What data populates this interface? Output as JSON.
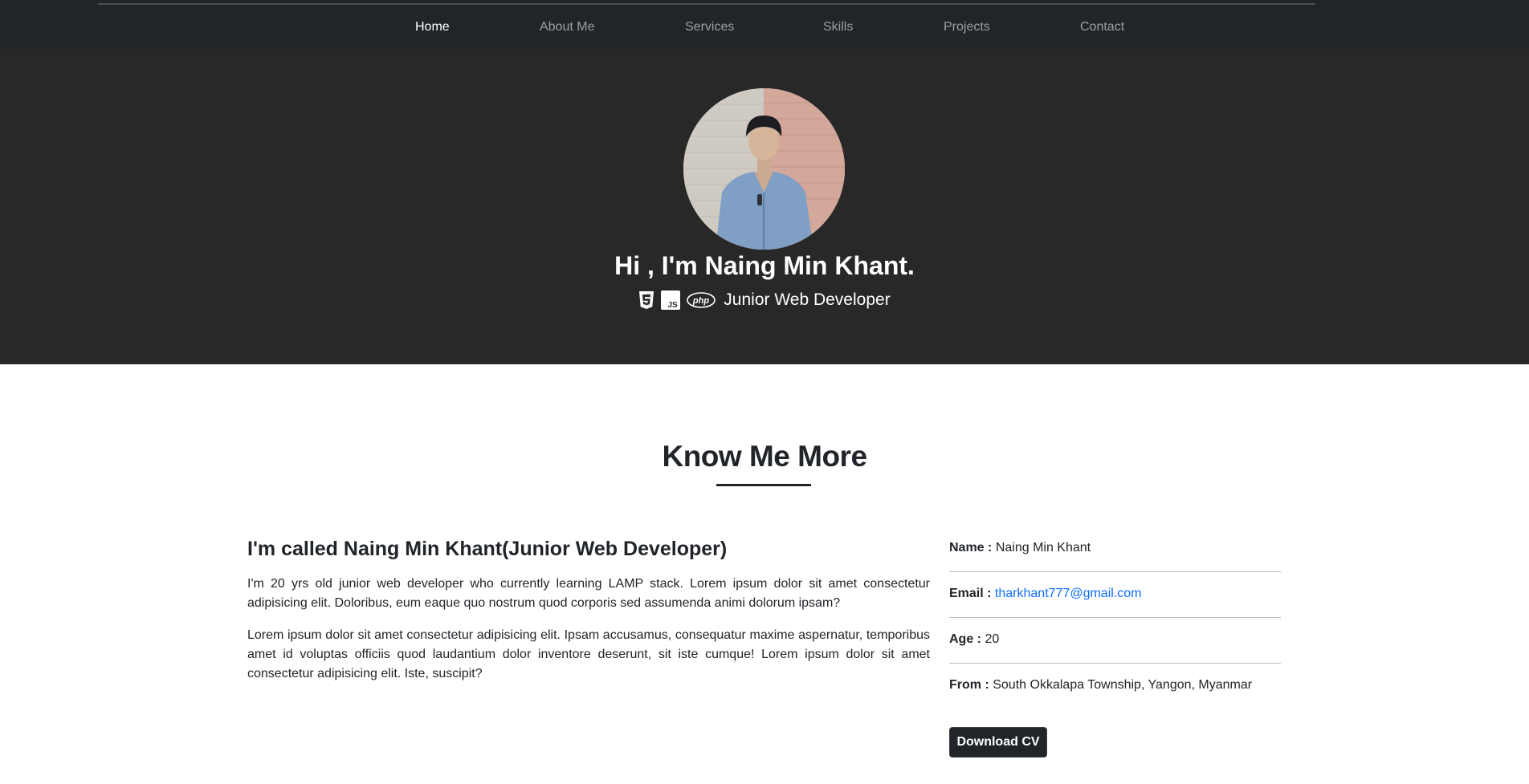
{
  "nav": {
    "items": [
      {
        "label": "Home",
        "active": true
      },
      {
        "label": "About Me"
      },
      {
        "label": "Services"
      },
      {
        "label": "Skills"
      },
      {
        "label": "Projects"
      },
      {
        "label": "Contact"
      }
    ]
  },
  "hero": {
    "title": "Hi , I'm Naing Min Khant.",
    "icons": [
      "html5-icon",
      "js-icon",
      "php-icon"
    ],
    "role": "Junior Web Developer"
  },
  "about": {
    "section_title": "Know Me More",
    "heading": "I'm called Naing Min Khant(Junior Web Developer)",
    "paragraphs": [
      "I'm 20 yrs old junior web developer who currently learning LAMP stack. Lorem ipsum dolor sit amet consectetur adipisicing elit. Doloribus, eum eaque quo nostrum quod corporis sed assumenda animi dolorum ipsam?",
      "Lorem ipsum dolor sit amet consectetur adipisicing elit. Ipsam accusamus, consequatur maxime aspernatur, temporibus amet id voluptas officiis quod laudantium dolor inventore deserunt, sit iste cumque! Lorem ipsum dolor sit amet consectetur adipisicing elit. Iste, suscipit?"
    ],
    "info": {
      "name_label": "Name :",
      "name_value": "Naing Min Khant",
      "email_label": "Email :",
      "email_value": "tharkhant777@gmail.com",
      "age_label": "Age :",
      "age_value": "20",
      "from_label": "From :",
      "from_value": "South Okkalapa Township, Yangon, Myanmar"
    },
    "download_label": "Download CV"
  },
  "colors": {
    "nav_bg": "#212529",
    "hero_bg": "#282828",
    "link": "#0d6efd"
  }
}
